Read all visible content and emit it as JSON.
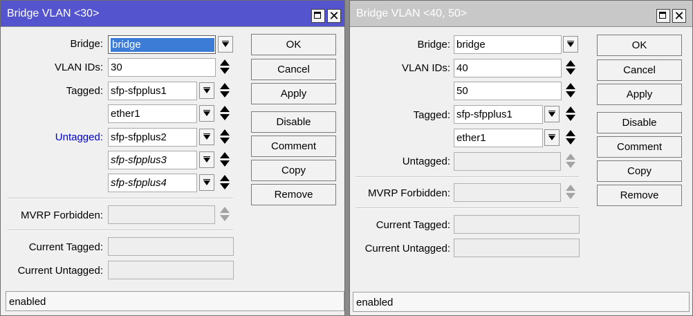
{
  "window1": {
    "title": "Bridge VLAN <30>",
    "max_label": "",
    "close_label": "✕",
    "labels": {
      "bridge": "Bridge:",
      "vlan_ids": "VLAN IDs:",
      "tagged": "Tagged:",
      "untagged": "Untagged:",
      "mvrp": "MVRP Forbidden:",
      "current_tagged": "Current Tagged:",
      "current_untagged": "Current Untagged:"
    },
    "untagged_label_color": "#0000cc",
    "bridge_value": "bridge",
    "vlan_ids": [
      "30"
    ],
    "tagged": [
      "sfp-sfpplus1",
      "ether1"
    ],
    "untagged": [
      "sfp-sfpplus2",
      "sfp-sfpplus3",
      "sfp-sfpplus4"
    ],
    "buttons": [
      "OK",
      "Cancel",
      "Apply",
      "Disable",
      "Comment",
      "Copy",
      "Remove"
    ],
    "status": "enabled"
  },
  "window2": {
    "title": "Bridge VLAN <40, 50>",
    "close_label": "✕",
    "labels": {
      "bridge": "Bridge:",
      "vlan_ids": "VLAN IDs:",
      "tagged": "Tagged:",
      "untagged": "Untagged:",
      "mvrp": "MVRP Forbidden:",
      "current_tagged": "Current Tagged:",
      "current_untagged": "Current Untagged:"
    },
    "bridge_value": "bridge",
    "vlan_ids": [
      "40",
      "50"
    ],
    "tagged": [
      "sfp-sfpplus1",
      "ether1"
    ],
    "buttons": [
      "OK",
      "Cancel",
      "Apply",
      "Disable",
      "Comment",
      "Copy",
      "Remove"
    ],
    "status": "enabled"
  }
}
